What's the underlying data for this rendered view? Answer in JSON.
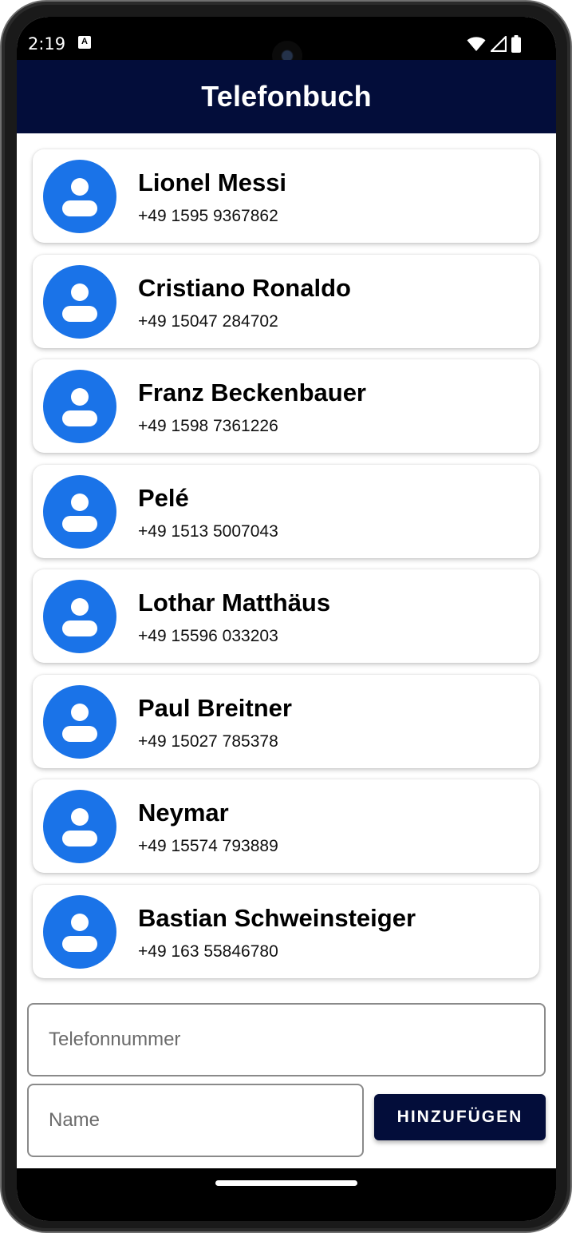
{
  "status_bar": {
    "time": "2:19",
    "notification_icon": "A",
    "icons": [
      "wifi-icon",
      "signal-icon",
      "battery-icon"
    ]
  },
  "app_bar": {
    "title": "Telefonbuch",
    "background": "#030d3a"
  },
  "contacts": [
    {
      "name": "Lionel Messi",
      "phone": "+49 1595 9367862"
    },
    {
      "name": "Cristiano Ronaldo",
      "phone": "+49 15047 284702"
    },
    {
      "name": "Franz Beckenbauer",
      "phone": "+49 1598 7361226"
    },
    {
      "name": "Pelé",
      "phone": "+49 1513 5007043"
    },
    {
      "name": "Lothar Matthäus",
      "phone": "+49 15596 033203"
    },
    {
      "name": "Paul Breitner",
      "phone": "+49 15027 785378"
    },
    {
      "name": "Neymar",
      "phone": "+49 15574 793889"
    },
    {
      "name": "Bastian Schweinsteiger",
      "phone": "+49 163 55846780"
    }
  ],
  "avatar": {
    "icon": "person-icon",
    "color": "#1a73e8"
  },
  "form": {
    "phone_placeholder": "Telefonnummer",
    "name_placeholder": "Name",
    "add_button_label": "HINZUFÜGEN"
  }
}
